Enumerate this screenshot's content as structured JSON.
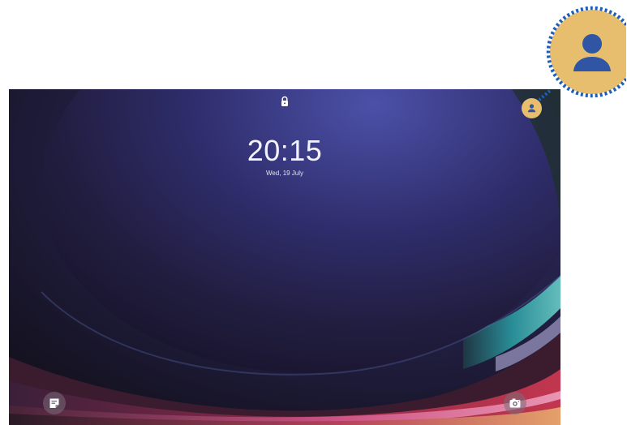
{
  "lockscreen": {
    "time": "20:15",
    "date": "Wed, 19 July"
  },
  "icons": {
    "lock": "lock-icon",
    "profile": "person-icon",
    "left_shortcut": "notes-icon",
    "right_shortcut": "camera-icon"
  },
  "colors": {
    "profile_badge": "#e7be6e",
    "profile_person": "#2f55a4",
    "callout_dots": "#1d5fb8"
  }
}
